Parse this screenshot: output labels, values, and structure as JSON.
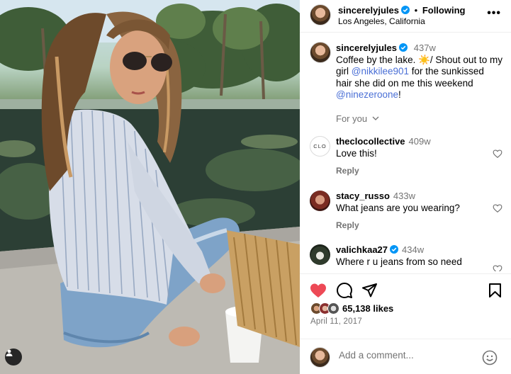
{
  "post": {
    "author": "sincerelyjules",
    "follow_label": "Following",
    "separator": "•",
    "location": "Los Angeles, California",
    "more_label": "•••"
  },
  "caption": {
    "username": "sincerelyjules",
    "age": "437w",
    "text_part1": "Coffee by the lake. ",
    "emoji": "☀️",
    "text_part2": "/ Shout out to my girl ",
    "mention1": "@nikkilee901",
    "text_part3": " for the sunkissed hair she did on me this weekend ",
    "mention2": "@ninezeroone",
    "text_part4": "!"
  },
  "for_you_label": "For you",
  "comments": [
    {
      "username": "theclocollective",
      "age": "409w",
      "text": "Love this!",
      "reply_label": "Reply",
      "avatar_text": "CLO",
      "verified": false
    },
    {
      "username": "stacy_russo",
      "age": "433w",
      "text": "What jeans are you wearing?",
      "reply_label": "Reply",
      "verified": false
    },
    {
      "username": "valichkaa27",
      "age": "434w",
      "text": "Where r u jeans from so need",
      "verified": true
    }
  ],
  "likes": {
    "count_text": "65,138 likes"
  },
  "date": "April 11, 2017",
  "comment_box": {
    "placeholder": "Add a comment..."
  },
  "colors": {
    "like_red": "#ed4956",
    "verified_blue": "#0095f6",
    "muted": "#737373",
    "mention": "#4a6fd6"
  }
}
